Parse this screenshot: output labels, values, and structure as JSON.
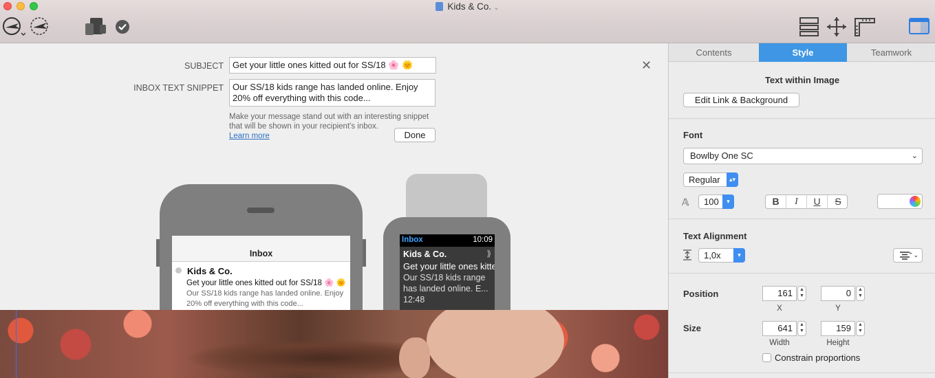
{
  "window": {
    "title": "Kids & Co."
  },
  "toolbar": {
    "left_icons": [
      "send-test-icon",
      "send-campaign-icon",
      "device-preview-icon",
      "checkmark-icon"
    ],
    "right_icons": [
      "layout-icon",
      "move-icon",
      "ruler-icon",
      "inspector-panel-icon"
    ]
  },
  "email": {
    "subject_label": "SUBJECT",
    "subject_value": "Get your little ones kitted out for SS/18 🌸 🌞",
    "snippet_label": "INBOX TEXT SNIPPET",
    "snippet_value": "Our SS/18 kids range has landed online. Enjoy 20% off everything with this code...",
    "hint": "Make your message stand out with an interesting snippet that will be shown in your recipient's inbox.",
    "learn_more": "Learn more",
    "done_label": "Done"
  },
  "phone_preview": {
    "header": "Inbox",
    "from": "Kids & Co.",
    "subject": "Get your little ones kitted out for SS/18 🌸 🌞",
    "snippet": "Our SS/18 kids range has landed online. Enjoy 20% off everything with this code..."
  },
  "watch_preview": {
    "inbox": "Inbox",
    "time": "10:09",
    "from": "Kids & Co.",
    "chevron": "⟫",
    "subject": "Get your little ones kitted out",
    "snippet": "Our SS/18 kids range has landed online. E...",
    "received": "12:48"
  },
  "inspector": {
    "tabs": [
      "Contents",
      "Style",
      "Teamwork"
    ],
    "active_tab": "Style",
    "section_title": "Text within Image",
    "edit_link_label": "Edit Link & Background",
    "font": {
      "heading": "Font",
      "family": "Bowlby One SC",
      "weight": "Regular",
      "size": "100",
      "bold": "B",
      "italic": "I",
      "underline": "U",
      "strike": "S"
    },
    "alignment": {
      "heading": "Text Alignment",
      "line_spacing": "1,0x"
    },
    "position": {
      "heading": "Position",
      "x": "161",
      "y": "0",
      "x_label": "X",
      "y_label": "Y"
    },
    "size": {
      "heading": "Size",
      "width": "641",
      "height": "159",
      "width_label": "Width",
      "height_label": "Height"
    },
    "constrain_label": "Constrain proportions",
    "colors": {
      "accent": "#3e96e4",
      "select_blue": "#3f8ef0"
    }
  }
}
